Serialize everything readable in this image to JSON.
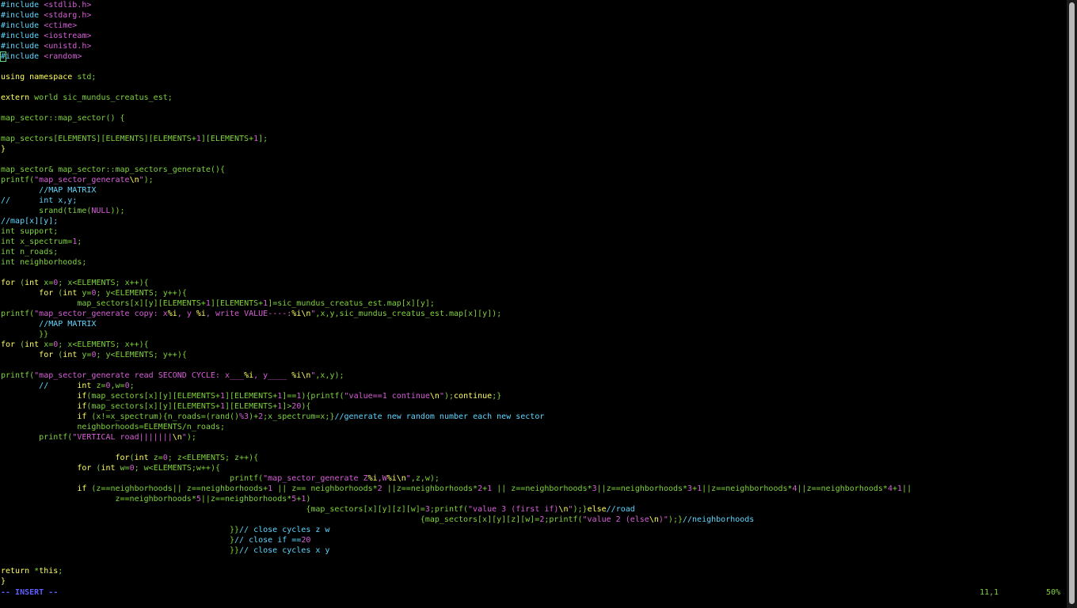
{
  "editor": {
    "lines": [
      [
        [
          "#include ",
          "pre"
        ],
        [
          "<stdlib.h>",
          "str"
        ]
      ],
      [
        [
          "#include ",
          "pre"
        ],
        [
          "<stdarg.h>",
          "str"
        ]
      ],
      [
        [
          "#include ",
          "pre"
        ],
        [
          "<ctime>",
          "str"
        ]
      ],
      [
        [
          "#include ",
          "pre"
        ],
        [
          "<iostream>",
          "str"
        ]
      ],
      [
        [
          "#include ",
          "pre"
        ],
        [
          "<unistd.h>",
          "str"
        ]
      ],
      [
        [
          "#include ",
          "pre"
        ],
        [
          "<random>",
          "str"
        ]
      ],
      [],
      [
        [
          "using namespace ",
          "kw"
        ],
        [
          "std;",
          "plain"
        ]
      ],
      [],
      [
        [
          "extern ",
          "kw"
        ],
        [
          "world sic_mundus_creatus_est;",
          "plain"
        ]
      ],
      [],
      [
        [
          "map_sector::map_sector() {",
          "plain"
        ]
      ],
      [],
      [
        [
          "map_sectors[ELEMENTS][ELEMENTS][ELEMENTS+",
          "plain"
        ],
        [
          "1",
          "num"
        ],
        [
          "][ELEMENTS+",
          "plain"
        ],
        [
          "1",
          "num"
        ],
        [
          "];",
          "plain"
        ]
      ],
      [
        [
          "}",
          "kw"
        ]
      ],
      [],
      [
        [
          "map_sector& map_sector::map_sectors_generate(){",
          "plain"
        ]
      ],
      [
        [
          "printf(",
          "plain"
        ],
        [
          "\"map_sector_generate",
          "str"
        ],
        [
          "\\n",
          "kw"
        ],
        [
          "\"",
          "str"
        ],
        [
          ");",
          "plain"
        ]
      ],
      [
        [
          "        ",
          "plain"
        ],
        [
          "//MAP MATRIX",
          "cmt"
        ]
      ],
      [
        [
          "//      ",
          "cmt"
        ],
        [
          "int x,y;",
          "cmt"
        ]
      ],
      [
        [
          "        srand(time(",
          "plain"
        ],
        [
          "NULL",
          "num"
        ],
        [
          "));",
          "plain"
        ]
      ],
      [
        [
          "//map[x][y];",
          "cmt"
        ]
      ],
      [
        [
          "int ",
          "type"
        ],
        [
          "support;",
          "plain"
        ]
      ],
      [
        [
          "int ",
          "type"
        ],
        [
          "x_spectrum=",
          "plain"
        ],
        [
          "1",
          "num"
        ],
        [
          ";",
          "plain"
        ]
      ],
      [
        [
          "int ",
          "type"
        ],
        [
          "n_roads;",
          "plain"
        ]
      ],
      [
        [
          "int ",
          "type"
        ],
        [
          "neighborhoods;",
          "plain"
        ]
      ],
      [],
      [
        [
          "for ",
          "kw"
        ],
        [
          "(",
          "plain"
        ],
        [
          "int ",
          "kw"
        ],
        [
          "x=",
          "plain"
        ],
        [
          "0",
          "num"
        ],
        [
          "; x<ELEMENTS; x++){",
          "plain"
        ]
      ],
      [
        [
          "        ",
          "plain"
        ],
        [
          "for ",
          "kw"
        ],
        [
          "(",
          "plain"
        ],
        [
          "int ",
          "kw"
        ],
        [
          "y=",
          "plain"
        ],
        [
          "0",
          "num"
        ],
        [
          "; y<ELEMENTS; y++){",
          "plain"
        ]
      ],
      [
        [
          "                map_sectors[x][y][ELEMENTS+",
          "plain"
        ],
        [
          "1",
          "num"
        ],
        [
          "][ELEMENTS+",
          "plain"
        ],
        [
          "1",
          "num"
        ],
        [
          "]=sic_mundus_creatus_est.map[x][y];",
          "plain"
        ]
      ],
      [
        [
          "printf(",
          "plain"
        ],
        [
          "\"map_sector_generate copy: x",
          "str"
        ],
        [
          "%i",
          "kw"
        ],
        [
          ", y ",
          "str"
        ],
        [
          "%i",
          "kw"
        ],
        [
          ", write VALUE----:",
          "str"
        ],
        [
          "%i",
          "kw"
        ],
        [
          "\\n",
          "kw"
        ],
        [
          "\"",
          "str"
        ],
        [
          ",x,y,sic_mundus_creatus_est.map[x][y]);",
          "plain"
        ]
      ],
      [
        [
          "        ",
          "plain"
        ],
        [
          "//MAP MATRIX",
          "cmt"
        ]
      ],
      [
        [
          "        }}",
          "plain"
        ]
      ],
      [
        [
          "for ",
          "kw"
        ],
        [
          "(",
          "plain"
        ],
        [
          "int ",
          "kw"
        ],
        [
          "x=",
          "plain"
        ],
        [
          "0",
          "num"
        ],
        [
          "; x<ELEMENTS; x++){",
          "plain"
        ]
      ],
      [
        [
          "        ",
          "plain"
        ],
        [
          "for ",
          "kw"
        ],
        [
          "(",
          "plain"
        ],
        [
          "int ",
          "kw"
        ],
        [
          "y=",
          "plain"
        ],
        [
          "0",
          "num"
        ],
        [
          "; y<ELEMENTS; y++){",
          "plain"
        ]
      ],
      [],
      [
        [
          "printf(",
          "plain"
        ],
        [
          "\"map_sector_generate read SECOND CYCLE: x___",
          "str"
        ],
        [
          "%i",
          "kw"
        ],
        [
          ", y____ ",
          "str"
        ],
        [
          "%i",
          "kw"
        ],
        [
          "\\n",
          "kw"
        ],
        [
          "\"",
          "str"
        ],
        [
          ",x,y);",
          "plain"
        ]
      ],
      [
        [
          "        ",
          "plain"
        ],
        [
          "//      ",
          "cmt"
        ],
        [
          "int ",
          "kw"
        ],
        [
          "z=",
          "plain"
        ],
        [
          "0",
          "num"
        ],
        [
          ",w=",
          "plain"
        ],
        [
          "0",
          "num"
        ],
        [
          ";",
          "plain"
        ]
      ],
      [
        [
          "                ",
          "plain"
        ],
        [
          "if",
          "kw"
        ],
        [
          "(map_sectors[x][y][ELEMENTS+",
          "plain"
        ],
        [
          "1",
          "num"
        ],
        [
          "][ELEMENTS+",
          "plain"
        ],
        [
          "1",
          "num"
        ],
        [
          "]==",
          "plain"
        ],
        [
          "1",
          "num"
        ],
        [
          "){printf(",
          "plain"
        ],
        [
          "\"value==1 continue",
          "str"
        ],
        [
          "\\n",
          "kw"
        ],
        [
          "\"",
          "str"
        ],
        [
          ");",
          "plain"
        ],
        [
          "continue",
          "kw"
        ],
        [
          ";}",
          "plain"
        ]
      ],
      [
        [
          "                ",
          "plain"
        ],
        [
          "if",
          "kw"
        ],
        [
          "(map_sectors[x][y][ELEMENTS+",
          "plain"
        ],
        [
          "1",
          "num"
        ],
        [
          "][ELEMENTS+",
          "plain"
        ],
        [
          "1",
          "num"
        ],
        [
          "]>",
          "plain"
        ],
        [
          "20",
          "num"
        ],
        [
          "){",
          "plain"
        ]
      ],
      [
        [
          "                ",
          "plain"
        ],
        [
          "if ",
          "kw"
        ],
        [
          "(x!=x_spectrum){n_roads=(rand()",
          "plain"
        ],
        [
          "%3",
          "num"
        ],
        [
          ")+",
          "plain"
        ],
        [
          "2",
          "num"
        ],
        [
          ";x_spectrum=x;}",
          "plain"
        ],
        [
          "//generate new random number each new sector",
          "cmt"
        ]
      ],
      [
        [
          "                neighborhoods=ELEMENTS/n_roads;",
          "plain"
        ]
      ],
      [
        [
          "        printf(",
          "plain"
        ],
        [
          "\"VERTICAL road|||||||",
          "str"
        ],
        [
          "\\n",
          "kw"
        ],
        [
          "\"",
          "str"
        ],
        [
          ");",
          "plain"
        ]
      ],
      [],
      [
        [
          "                        ",
          "plain"
        ],
        [
          "for",
          "kw"
        ],
        [
          "(",
          "plain"
        ],
        [
          "int ",
          "kw"
        ],
        [
          "z=",
          "plain"
        ],
        [
          "0",
          "num"
        ],
        [
          "; z<ELEMENTS; z++){",
          "plain"
        ]
      ],
      [
        [
          "                ",
          "plain"
        ],
        [
          "for ",
          "kw"
        ],
        [
          "(",
          "plain"
        ],
        [
          "int ",
          "kw"
        ],
        [
          "w=",
          "plain"
        ],
        [
          "0",
          "num"
        ],
        [
          "; w<ELEMENTS;w++){",
          "plain"
        ]
      ],
      [
        [
          "                                                printf(",
          "plain"
        ],
        [
          "\"map_sector_generate Z",
          "str"
        ],
        [
          "%i",
          "kw"
        ],
        [
          ",W",
          "str"
        ],
        [
          "%i",
          "kw"
        ],
        [
          "\\n",
          "kw"
        ],
        [
          "\"",
          "str"
        ],
        [
          ",z,w);",
          "plain"
        ]
      ],
      [
        [
          "                ",
          "plain"
        ],
        [
          "if ",
          "kw"
        ],
        [
          "(z==neighborhoods|| z==neighborhoods+",
          "plain"
        ],
        [
          "1",
          "num"
        ],
        [
          " || z== neighborhoods*",
          "plain"
        ],
        [
          "2",
          "num"
        ],
        [
          " ||z==neighborhoods*",
          "plain"
        ],
        [
          "2",
          "num"
        ],
        [
          "+",
          "plain"
        ],
        [
          "1",
          "num"
        ],
        [
          " || z==neighborhoods*",
          "plain"
        ],
        [
          "3",
          "num"
        ],
        [
          "||z==neighborhoods*",
          "plain"
        ],
        [
          "3",
          "num"
        ],
        [
          "+",
          "plain"
        ],
        [
          "1",
          "num"
        ],
        [
          "||z==neighborhoods*",
          "plain"
        ],
        [
          "4",
          "num"
        ],
        [
          "||z==neighborhoods*",
          "plain"
        ],
        [
          "4",
          "num"
        ],
        [
          "+",
          "plain"
        ],
        [
          "1",
          "num"
        ],
        [
          "||",
          "plain"
        ]
      ],
      [
        [
          "                        z==neighborhoods*",
          "plain"
        ],
        [
          "5",
          "num"
        ],
        [
          "||z==neighborhoods*",
          "plain"
        ],
        [
          "5",
          "num"
        ],
        [
          "+",
          "plain"
        ],
        [
          "1",
          "num"
        ],
        [
          ")",
          "plain"
        ]
      ],
      [
        [
          "                                                                {map_sectors[x][y][z][w]=",
          "plain"
        ],
        [
          "3",
          "num"
        ],
        [
          ";printf(",
          "plain"
        ],
        [
          "\"value 3 (first if)",
          "str"
        ],
        [
          "\\n",
          "kw"
        ],
        [
          "\"",
          "str"
        ],
        [
          ");}",
          "plain"
        ],
        [
          "else",
          "kw"
        ],
        [
          "//road",
          "cmt"
        ]
      ],
      [
        [
          "                                                                                        {map_sectors[x][y][z][w]=",
          "plain"
        ],
        [
          "2",
          "num"
        ],
        [
          ";printf(",
          "plain"
        ],
        [
          "\"value 2 (else",
          "str"
        ],
        [
          "\\n",
          "kw"
        ],
        [
          ")\"",
          "str"
        ],
        [
          ");}",
          "plain"
        ],
        [
          "//neighborhoods",
          "cmt"
        ]
      ],
      [
        [
          "                                                }}",
          "plain"
        ],
        [
          "// close cycles z w",
          "cmt"
        ]
      ],
      [
        [
          "                                                }",
          "plain"
        ],
        [
          "// close if ==",
          "cmt"
        ],
        [
          "20",
          "num"
        ]
      ],
      [
        [
          "                                                }}",
          "plain"
        ],
        [
          "// close cycles x y",
          "cmt"
        ]
      ],
      [],
      [
        [
          "return ",
          "kw"
        ],
        [
          "*",
          "plain"
        ],
        [
          "this",
          "kw"
        ],
        [
          ";",
          "plain"
        ]
      ],
      [
        [
          "}",
          "kw"
        ]
      ]
    ]
  },
  "status": {
    "mode": "-- INSERT --",
    "position": "11,1",
    "percent": "50%"
  },
  "colors": {
    "background": "#000000",
    "preprocessor": "#5fd7ff",
    "string": "#d75fd7",
    "keyword": "#ffff5f",
    "comment": "#5fd7ff",
    "plain": "#7fd23c",
    "mode": "#5f5fff"
  }
}
